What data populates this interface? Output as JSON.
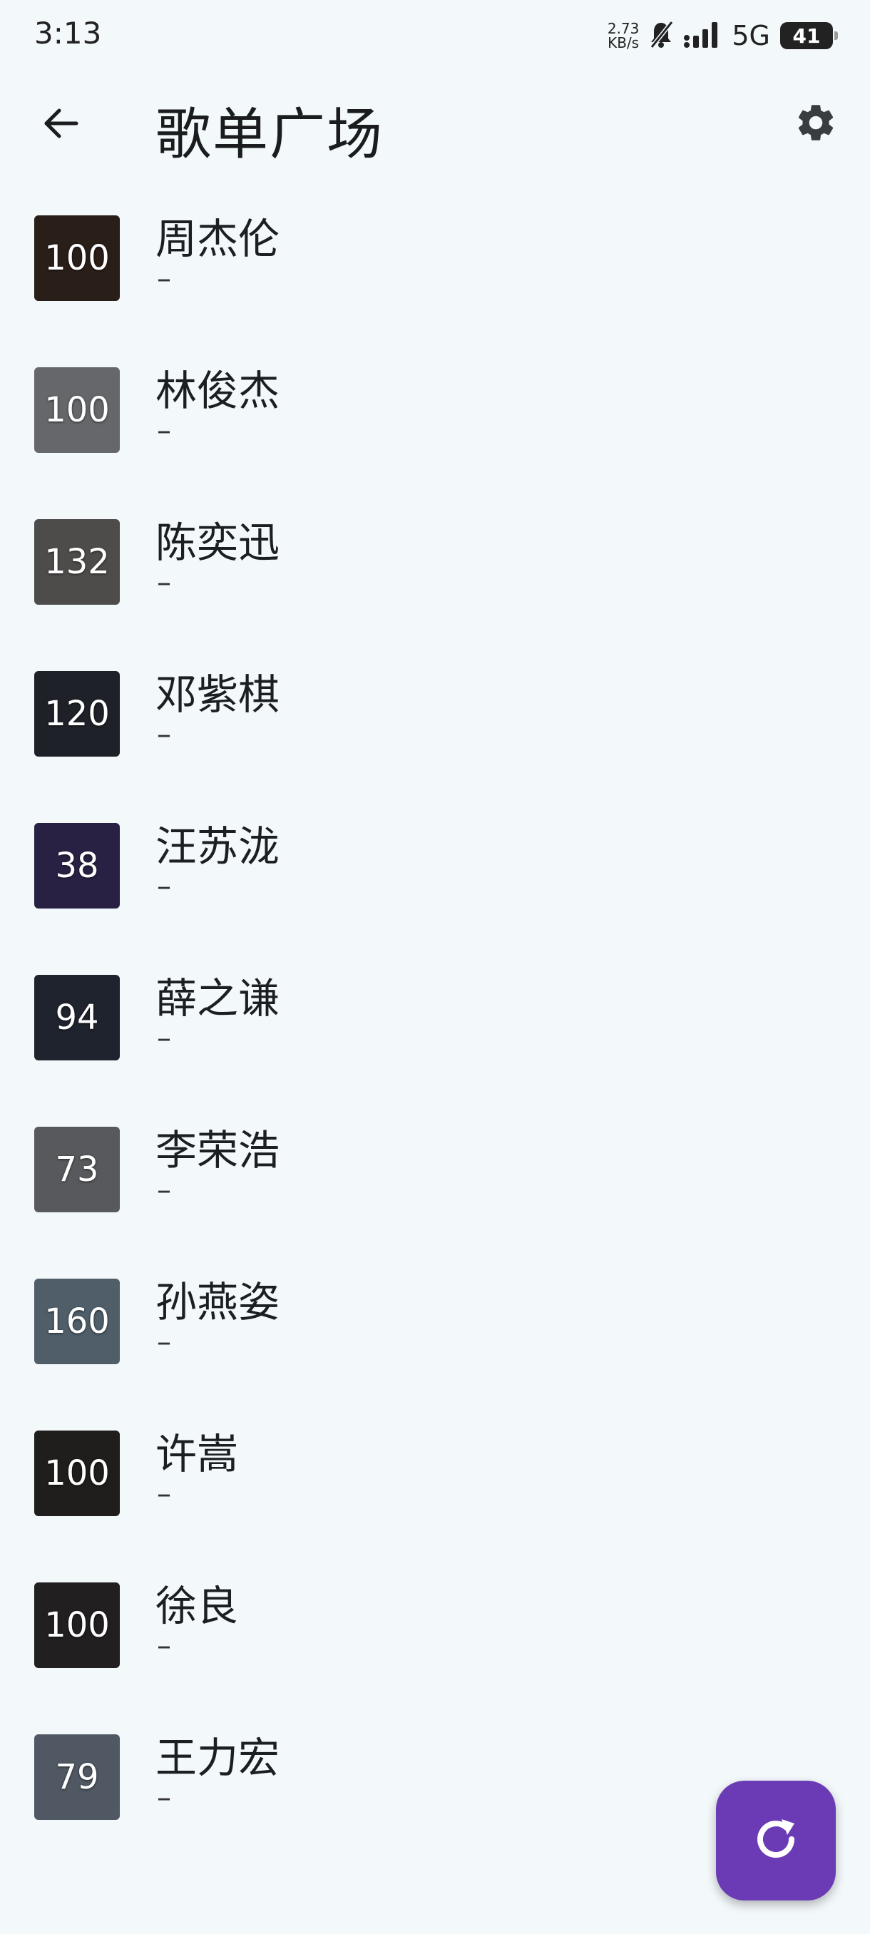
{
  "status_bar": {
    "time": "3:13",
    "net_speed_value": "2.73",
    "net_speed_unit": "KB/s",
    "network": "5G",
    "battery": "41"
  },
  "app_bar": {
    "title": "歌单广场"
  },
  "colors": {
    "background": "#f3f8fb",
    "fab": "#6a3bb5"
  },
  "playlists": [
    {
      "title": "周杰伦",
      "subtitle": "–",
      "count": "100",
      "thumb_color": "#3a2a22"
    },
    {
      "title": "林俊杰",
      "subtitle": "–",
      "count": "100",
      "thumb_color": "#8d8f95"
    },
    {
      "title": "陈奕迅",
      "subtitle": "–",
      "count": "132",
      "thumb_color": "#6d6a68"
    },
    {
      "title": "邓紫棋",
      "subtitle": "–",
      "count": "120",
      "thumb_color": "#2a3038"
    },
    {
      "title": "汪苏泷",
      "subtitle": "–",
      "count": "38",
      "thumb_color": "#3a2f5e"
    },
    {
      "title": "薛之谦",
      "subtitle": "–",
      "count": "94",
      "thumb_color": "#2c3140"
    },
    {
      "title": "李荣浩",
      "subtitle": "–",
      "count": "73",
      "thumb_color": "#7b7c80"
    },
    {
      "title": "孙燕姿",
      "subtitle": "–",
      "count": "160",
      "thumb_color": "#6f8392"
    },
    {
      "title": "许嵩",
      "subtitle": "–",
      "count": "100",
      "thumb_color": "#2b2a28"
    },
    {
      "title": "徐良",
      "subtitle": "–",
      "count": "100",
      "thumb_color": "#2e2b2d"
    },
    {
      "title": "王力宏",
      "subtitle": "–",
      "count": "79",
      "thumb_color": "#6f7a8a"
    }
  ]
}
